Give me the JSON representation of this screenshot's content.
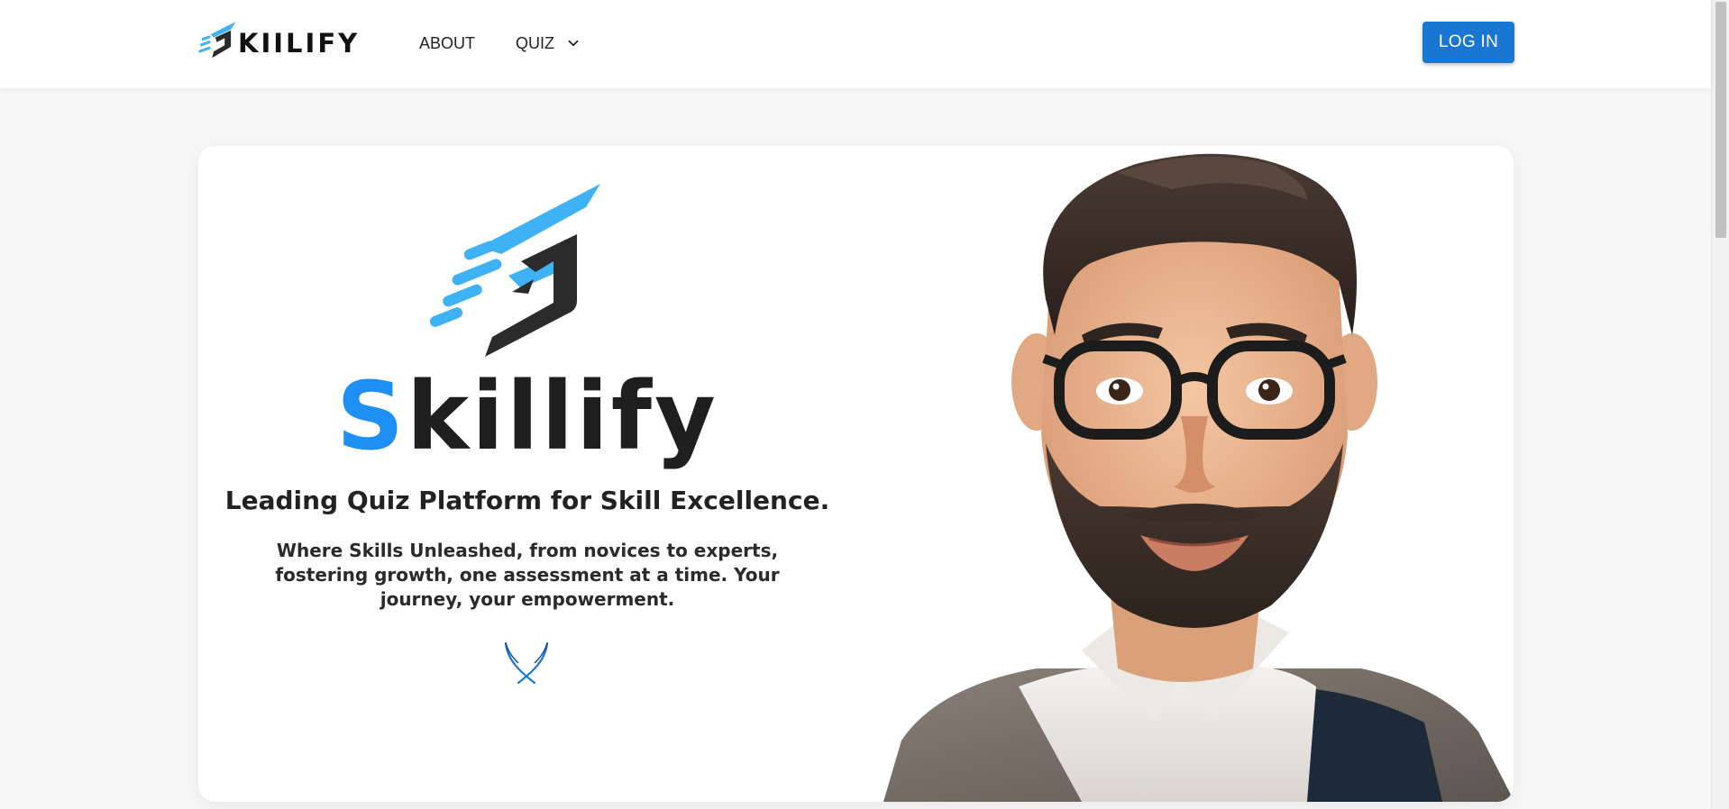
{
  "header": {
    "brand_name": "KIILIFY",
    "nav": {
      "about_label": "ABOUT",
      "quiz_label": "QUIZ"
    },
    "login_label": "LOG IN"
  },
  "hero": {
    "wordmark_first": "S",
    "wordmark_rest": "killify",
    "tagline": "Leading Quiz Platform for Skill Excellence.",
    "description": "Where Skills Unleashed, from novices to experts, fostering growth, one assessment at a time. Your journey, your empowerment."
  },
  "icons": {
    "brand_mark": "skillify-s-logo-icon",
    "quiz_dropdown": "chevron-down-icon",
    "scroll_cue": "scroll-down-arrow-icon",
    "portrait": "bearded-man-avatar"
  },
  "colors": {
    "primary": "#1976d2",
    "brand_blue": "#1e90f5",
    "logo_light_blue": "#3fb1f5",
    "logo_dark": "#2b2b2b",
    "text_dark": "#222222"
  }
}
